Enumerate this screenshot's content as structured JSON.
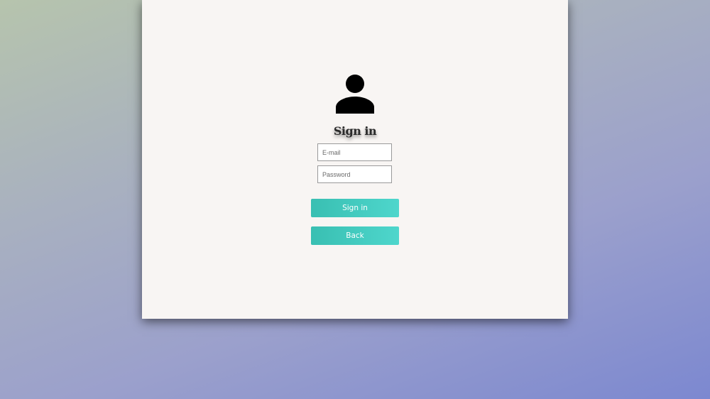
{
  "login": {
    "title": "Sign in",
    "email_placeholder": "E-mail",
    "password_placeholder": "Password",
    "signin_label": "Sign in",
    "back_label": "Back"
  },
  "colors": {
    "button_gradient_start": "#39bfb2",
    "button_gradient_end": "#4ed6cc",
    "card_background": "#f8f5f3"
  },
  "icons": {
    "avatar": "user-icon"
  }
}
